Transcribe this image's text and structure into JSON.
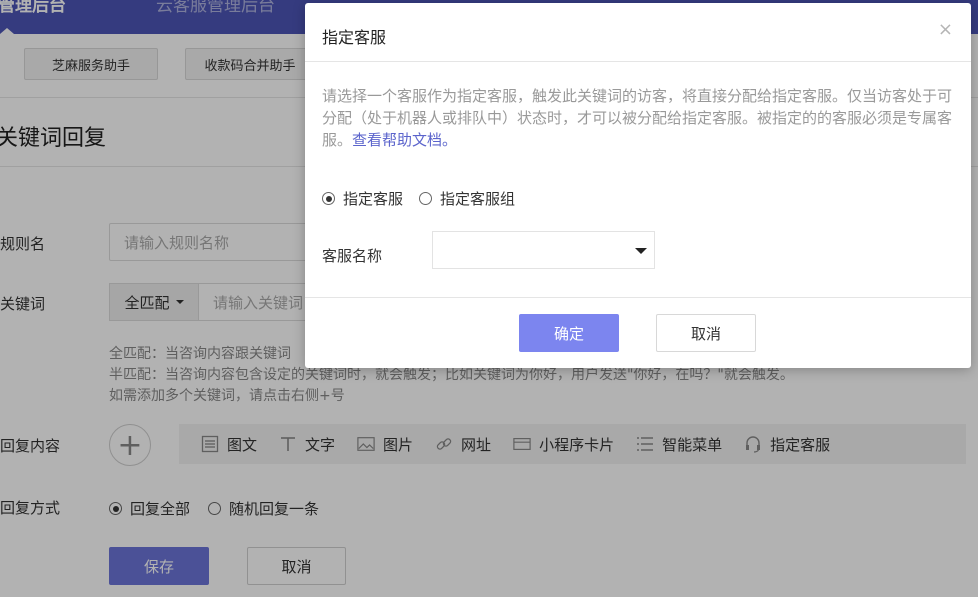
{
  "topnav": {
    "tabs": [
      "管理后台",
      "云客服管理后台",
      "",
      "",
      "",
      ""
    ]
  },
  "subbar": {
    "btn1": "芝麻服务助手",
    "btn2": "收款码合并助手"
  },
  "page": {
    "title": "关键词回复",
    "rule_label": "规则名",
    "rule_placeholder": "请输入规则名称",
    "kw_label": "关键词",
    "kw_mode": "全匹配",
    "kw_placeholder": "请输入关键词",
    "hint1": "全匹配：当咨询内容跟关键词",
    "hint2": "半匹配：当咨询内容包含设定的关键词时，就会触发；比如关键词为你好，用户发送\"你好，在吗？\"就会触发。",
    "hint3": "如需添加多个关键词，请点击右侧+号",
    "reply_label": "回复内容",
    "reply_types": [
      {
        "icon": "image-text-icon",
        "label": "图文"
      },
      {
        "icon": "text-icon",
        "label": "文字"
      },
      {
        "icon": "picture-icon",
        "label": "图片"
      },
      {
        "icon": "link-icon",
        "label": "网址"
      },
      {
        "icon": "card-icon",
        "label": "小程序卡片"
      },
      {
        "icon": "menu-icon",
        "label": "智能菜单"
      },
      {
        "icon": "headset-icon",
        "label": "指定客服"
      }
    ],
    "mode_label": "回复方式",
    "mode_all": "回复全部",
    "mode_random": "随机回复一条",
    "save": "保存",
    "cancel": "取消"
  },
  "modal": {
    "title": "指定客服",
    "close": "×",
    "desc": "请选择一个客服作为指定客服，触发此关键词的访客，将直接分配给指定客服。仅当访客处于可分配（处于机器人或排队中）状态时，才可以被分配给指定客服。被指定的的客服必须是专属客服。",
    "help_link": "查看帮助文档。",
    "radio_agent": "指定客服",
    "radio_group": "指定客服组",
    "field_label": "客服名称",
    "ok": "确定",
    "cancel": "取消"
  }
}
